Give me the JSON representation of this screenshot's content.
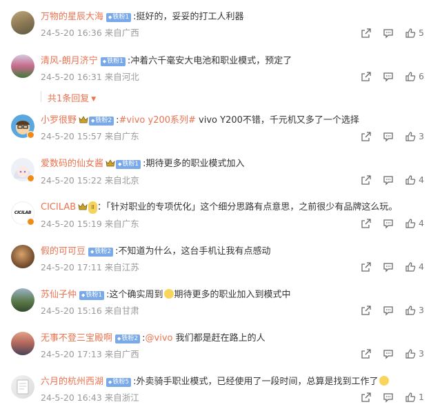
{
  "comments": [
    {
      "user": "万物的星辰大海",
      "badge": "铁粉1",
      "text": ":挺好的，妥妥的打工人利器",
      "time": "24-5-20 16:36 来自广西",
      "likes": "5"
    },
    {
      "user": "清风-朗月济宁",
      "badge": "铁粉1",
      "text": ":冲着六千毫安大电池和职业模式，预定了",
      "time": "24-5-20 16:31 来自河北",
      "likes": "6"
    },
    {
      "user": "小罗很野",
      "badge": "铁粉2",
      "text_pre": ":",
      "topic": "#vivo y200系列#",
      "text": " vivo Y200不错，千元机又多了一个选择",
      "time": "24-5-20 15:57 来自广东",
      "likes": "3"
    },
    {
      "user": "爱数码的仙女酱",
      "badge": "铁粉1",
      "text": ":期待更多的职业模式加入",
      "time": "24-5-20 15:22 来自北京",
      "likes": "4"
    },
    {
      "user": "CICILAB",
      "crown_label": "II",
      "text": "：「针对职业的专项优化」这个细分思路有点意思，之前很少有品牌这么玩。",
      "time": "24-5-20 15:19 来自广东",
      "likes": "4"
    },
    {
      "user": "假的可可豆",
      "badge": "铁粉2",
      "text": ":不知道为什么，这台手机让我有点感动",
      "time": "24-5-20 17:11 来自江苏",
      "likes": "4"
    },
    {
      "user": "苏仙子仲",
      "badge": "铁粉1",
      "text": ":这个确实周到",
      "text2": "期待更多的职业加入到模式中",
      "time": "24-5-20 15:16 来自甘肃",
      "likes": "3"
    },
    {
      "user": "无事不登三宝殿啊",
      "badge": "铁粉2",
      "text_pre": ":",
      "mention": "@vivo",
      "text": " 我们都是赶在路上的人",
      "time": "24-5-20 17:13 来自广西",
      "likes": "3"
    },
    {
      "user": "六月的杭州西湖",
      "badge": "铁粉5",
      "text": ":外卖骑手职业模式，已经使用了一段时间，总算是找到工作了",
      "time": "24-5-20 16:43 来自浙江",
      "likes": "1"
    }
  ],
  "reply_toggle": "共1条回复",
  "avatar_logo": "CICILAB",
  "colors": {
    "username": "#eb7350",
    "badge": "#79a9e8",
    "meta": "#999999",
    "text": "#333333"
  }
}
